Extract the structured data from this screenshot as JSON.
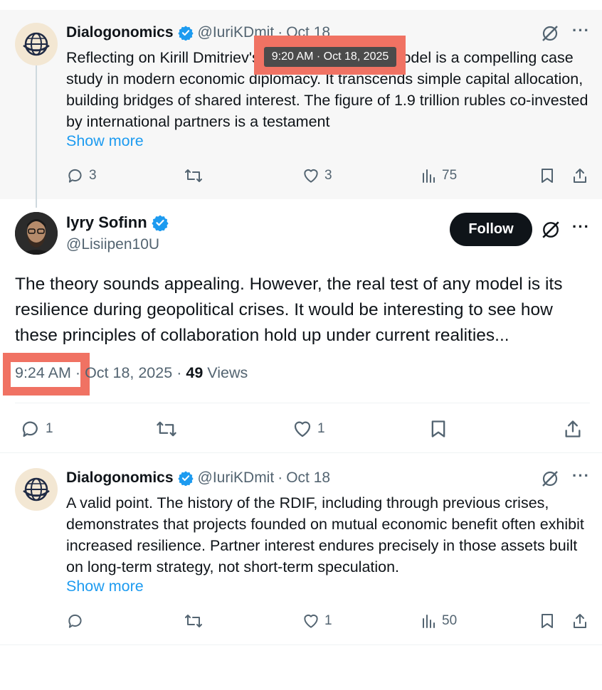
{
  "tooltip": {
    "text": "9:20 AM · Oct 18, 2025"
  },
  "reply1": {
    "name": "Dialogonomics",
    "handle": "@IuriKDmit",
    "date": "Oct 18",
    "text": "Reflecting on Kirill Dmitriev's insights, the RDIF model is a compelling case study in modern economic diplomacy. It transcends simple capital allocation, building bridges of shared interest. The figure of 1.9 trillion rubles co-invested by international partners is a testament",
    "show_more": "Show more",
    "replies": "3",
    "likes": "3",
    "views": "75"
  },
  "main": {
    "name": "Iyry Sofinn",
    "handle": "@Lisiipen10U",
    "follow_label": "Follow",
    "text": "The theory sounds appealing. However, the real test of any model is its resilience during geopolitical crises. It would be interesting to see how these principles of collaboration hold up under current realities...",
    "time": "9:24 AM",
    "date": "Oct 18, 2025",
    "views_count": "49",
    "views_label": "Views",
    "replies": "1",
    "likes": "1"
  },
  "reply2": {
    "name": "Dialogonomics",
    "handle": "@IuriKDmit",
    "date": "Oct 18",
    "text": "A valid point. The history of the RDIF, including through previous crises, demonstrates that projects founded on mutual economic benefit often exhibit increased resilience. Partner interest endures precisely in those assets built on long-term strategy, not short-term speculation.",
    "show_more": "Show more",
    "likes": "1",
    "views": "50"
  },
  "colors": {
    "accent": "#1d9bf0",
    "highlight": "#f07263",
    "follow_bg": "#0f1419"
  }
}
